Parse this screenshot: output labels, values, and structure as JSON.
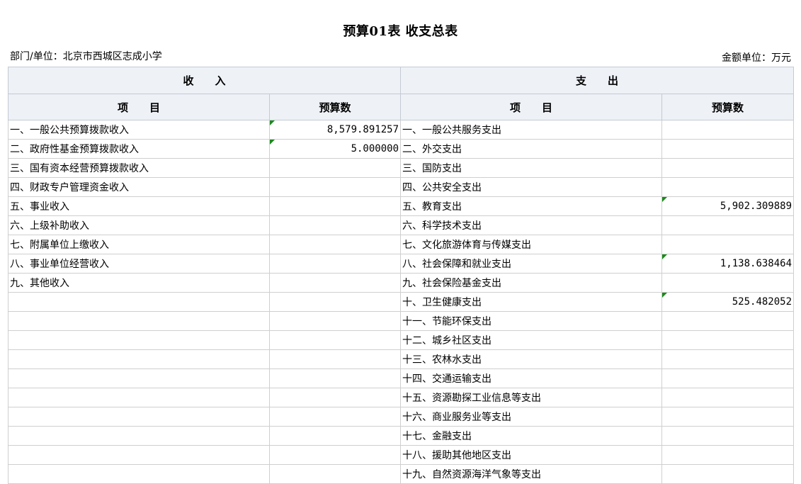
{
  "title": "预算01表  收支总表",
  "department_label": "部门/单位：北京市西城区志成小学",
  "unit_label": "金额单位：万元",
  "header": {
    "income": "收　　入",
    "expense": "支　　出",
    "item": "项　　目",
    "budget": "预算数"
  },
  "rows": [
    {
      "income_item": "一、一般公共预算拨款收入",
      "income_value": "8,579.891257",
      "expense_item": "一、一般公共服务支出",
      "expense_value": ""
    },
    {
      "income_item": "二、政府性基金预算拨款收入",
      "income_value": "5.000000",
      "expense_item": "二、外交支出",
      "expense_value": ""
    },
    {
      "income_item": "三、国有资本经营预算拨款收入",
      "income_value": "",
      "expense_item": "三、国防支出",
      "expense_value": ""
    },
    {
      "income_item": "四、财政专户管理资金收入",
      "income_value": "",
      "expense_item": "四、公共安全支出",
      "expense_value": ""
    },
    {
      "income_item": "五、事业收入",
      "income_value": "",
      "expense_item": "五、教育支出",
      "expense_value": "5,902.309889"
    },
    {
      "income_item": "六、上级补助收入",
      "income_value": "",
      "expense_item": "六、科学技术支出",
      "expense_value": ""
    },
    {
      "income_item": "七、附属单位上缴收入",
      "income_value": "",
      "expense_item": "七、文化旅游体育与传媒支出",
      "expense_value": ""
    },
    {
      "income_item": "八、事业单位经营收入",
      "income_value": "",
      "expense_item": "八、社会保障和就业支出",
      "expense_value": "1,138.638464"
    },
    {
      "income_item": "九、其他收入",
      "income_value": "",
      "expense_item": "九、社会保险基金支出",
      "expense_value": ""
    },
    {
      "income_item": "",
      "income_value": "",
      "expense_item": "十、卫生健康支出",
      "expense_value": "525.482052"
    },
    {
      "income_item": "",
      "income_value": "",
      "expense_item": "十一、节能环保支出",
      "expense_value": ""
    },
    {
      "income_item": "",
      "income_value": "",
      "expense_item": "十二、城乡社区支出",
      "expense_value": ""
    },
    {
      "income_item": "",
      "income_value": "",
      "expense_item": "十三、农林水支出",
      "expense_value": ""
    },
    {
      "income_item": "",
      "income_value": "",
      "expense_item": "十四、交通运输支出",
      "expense_value": ""
    },
    {
      "income_item": "",
      "income_value": "",
      "expense_item": "十五、资源勘探工业信息等支出",
      "expense_value": ""
    },
    {
      "income_item": "",
      "income_value": "",
      "expense_item": "十六、商业服务业等支出",
      "expense_value": ""
    },
    {
      "income_item": "",
      "income_value": "",
      "expense_item": "十七、金融支出",
      "expense_value": ""
    },
    {
      "income_item": "",
      "income_value": "",
      "expense_item": "十八、援助其他地区支出",
      "expense_value": ""
    },
    {
      "income_item": "",
      "income_value": "",
      "expense_item": "十九、自然资源海洋气象等支出",
      "expense_value": ""
    }
  ],
  "colors": {
    "header_bg": "#eef1f6",
    "grid": "#cfcfcf",
    "flag": "#1a8a1a"
  }
}
